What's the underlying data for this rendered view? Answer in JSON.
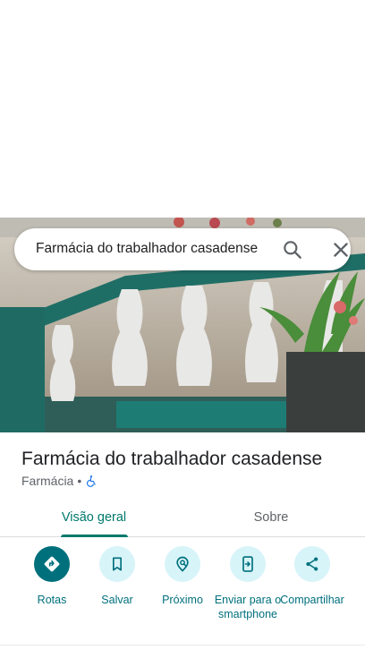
{
  "search": {
    "query": "Farmácia do trabalhador casadense"
  },
  "place": {
    "name": "Farmácia do trabalhador casadense",
    "category": "Farmácia",
    "separator": "•"
  },
  "tabs": [
    {
      "label": "Visão geral",
      "selected": true
    },
    {
      "label": "Sobre",
      "selected": false
    }
  ],
  "actions": [
    {
      "label": "Rotas",
      "icon": "directions-icon"
    },
    {
      "label": "Salvar",
      "icon": "bookmark-icon"
    },
    {
      "label": "Próximo",
      "icon": "nearby-icon"
    },
    {
      "label": "Enviar para o smartphone",
      "icon": "send-to-phone-icon"
    },
    {
      "label": "Compartilhar",
      "icon": "share-icon"
    }
  ],
  "colors": {
    "accent": "#00707d",
    "accent_light": "#d7f4f9",
    "tab_active": "#00796b",
    "accessibility": "#1a73e8"
  }
}
